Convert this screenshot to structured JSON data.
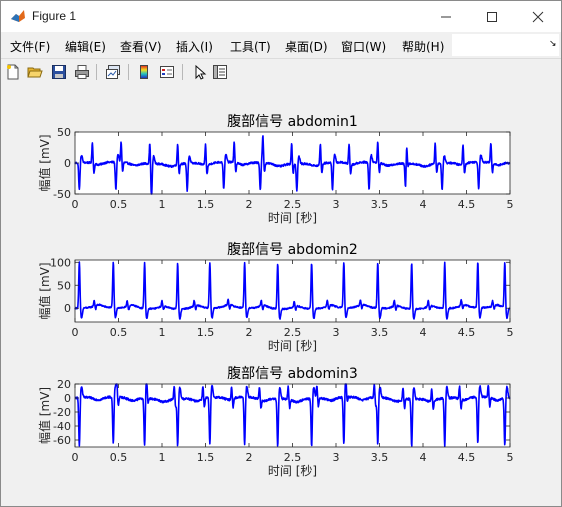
{
  "window": {
    "title": "Figure 1"
  },
  "menu": [
    "文件(F)",
    "编辑(E)",
    "查看(V)",
    "插入(I)",
    "工具(T)",
    "桌面(D)",
    "窗口(W)",
    "帮助(H)"
  ],
  "toolbar": [
    {
      "icon": "new-figure-icon"
    },
    {
      "icon": "open-file-icon"
    },
    {
      "icon": "save-icon"
    },
    {
      "icon": "print-icon"
    },
    {
      "icon": "link-plot-icon"
    },
    {
      "icon": "insert-colorbar-icon"
    },
    {
      "icon": "insert-legend-icon"
    },
    {
      "icon": "edit-plot-icon"
    },
    {
      "icon": "property-inspector-icon"
    }
  ],
  "colors": {
    "line": "#0000ff",
    "axes_bg": "#ffffff",
    "figure_bg": "#f0f0f0"
  },
  "chart_data": [
    {
      "type": "line",
      "title": "腹部信号 abdomin1",
      "xlabel": "时间 [秒]",
      "ylabel": "幅值 [mV]",
      "xlim": [
        0,
        5
      ],
      "ylim": [
        -50,
        50
      ],
      "xticks": [
        "0",
        "0.5",
        "1",
        "1.5",
        "2",
        "2.5",
        "3",
        "3.5",
        "4",
        "4.5",
        "5"
      ],
      "yticks": [
        "-50",
        "0",
        "50"
      ],
      "series": [
        {
          "color": "#0000ff",
          "waveform": {
            "baseline": 0,
            "noise": 3,
            "maternal": {
              "times": [
                0.05,
                0.47,
                0.88,
                1.29,
                1.71,
                2.13,
                2.55,
                2.96,
                3.38,
                3.8,
                4.22,
                4.64
              ],
              "peak": -44,
              "rebound": 12
            },
            "fetal": {
              "times": [
                0.2,
                0.53,
                0.86,
                1.18,
                1.5,
                1.83,
                2.16,
                2.49,
                2.82,
                3.15,
                3.48,
                3.81,
                4.14,
                4.46,
                4.78
              ],
              "peak": 33,
              "trough": -15
            }
          }
        }
      ]
    },
    {
      "type": "line",
      "title": "腹部信号 abdomin2",
      "xlabel": "时间 [秒]",
      "ylabel": "幅值 [mV]",
      "xlim": [
        0,
        5
      ],
      "ylim": [
        -30,
        105
      ],
      "xticks": [
        "0",
        "0.5",
        "1",
        "1.5",
        "2",
        "2.5",
        "3",
        "3.5",
        "4",
        "4.5",
        "5"
      ],
      "yticks": [
        "0",
        "50",
        "100"
      ],
      "series": [
        {
          "color": "#0000ff",
          "waveform": {
            "baseline": 0,
            "noise": 3,
            "maternal": {
              "times": [
                0.05,
                0.44,
                0.8,
                1.18,
                1.55,
                1.95,
                2.33,
                2.72,
                3.09,
                3.48,
                3.87,
                4.25,
                4.63,
                4.94
              ],
              "peak": 100,
              "rebound": -22
            },
            "fetal": {
              "times": [
                0.22,
                0.6,
                1.0,
                1.37,
                1.76,
                2.14,
                2.52,
                2.9,
                3.28,
                3.67,
                4.06,
                4.44,
                4.8
              ],
              "peak": 12,
              "trough": -8
            }
          }
        }
      ]
    },
    {
      "type": "line",
      "title": "腹部信号 abdomin3",
      "xlabel": "时间 [秒]",
      "ylabel": "幅值 [mV]",
      "xlim": [
        0,
        5
      ],
      "ylim": [
        -70,
        20
      ],
      "xticks": [
        "0",
        "0.5",
        "1",
        "1.5",
        "2",
        "2.5",
        "3",
        "3.5",
        "4",
        "4.5",
        "5"
      ],
      "yticks": [
        "-60",
        "-40",
        "-20",
        "0",
        "20"
      ],
      "series": [
        {
          "color": "#0000ff",
          "waveform": {
            "baseline": 0,
            "noise": 3,
            "maternal": {
              "times": [
                0.05,
                0.44,
                0.8,
                1.18,
                1.55,
                1.95,
                2.33,
                2.72,
                3.09,
                3.48,
                3.87,
                4.25,
                4.63,
                4.94
              ],
              "peak": -68,
              "rebound": 16
            },
            "fetal": {
              "times": [
                0.48,
                0.82,
                1.14,
                1.47,
                1.8,
                2.12,
                2.45,
                2.78,
                3.11,
                3.44,
                3.77,
                4.1,
                4.42,
                4.75
              ],
              "peak": 18,
              "trough": -12
            }
          }
        }
      ]
    }
  ]
}
